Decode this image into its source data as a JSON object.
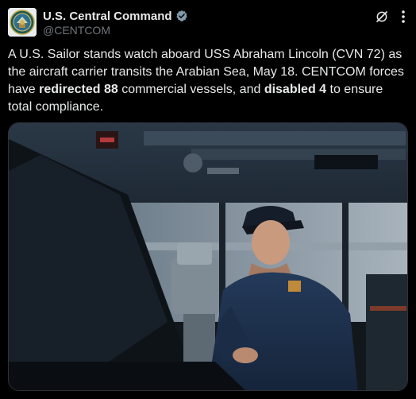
{
  "account": {
    "display_name": "U.S. Central Command",
    "handle": "@CENTCOM",
    "verified_color": "#829aab",
    "avatar_icon": "centcom-seal-icon"
  },
  "actions": {
    "grok_icon": "grok-icon",
    "more_icon": "more-dots-icon"
  },
  "tweet": {
    "text_before_1": "A U.S. Sailor stands watch aboard USS Abraham Lincoln (CVN 72) as the aircraft carrier transits the Arabian Sea, May 18. CENTCOM forces have ",
    "bold_1": "redirected 88",
    "text_between": " commercial vessels, and ",
    "bold_2": "disabled 4",
    "text_after_2": " to ensure total compliance."
  },
  "media": {
    "description_icon": "photo-sailor-bridge"
  },
  "colors": {
    "background": "#000000",
    "text": "#e7e9ea",
    "secondary_text": "#71767b",
    "border": "#2f3336"
  }
}
